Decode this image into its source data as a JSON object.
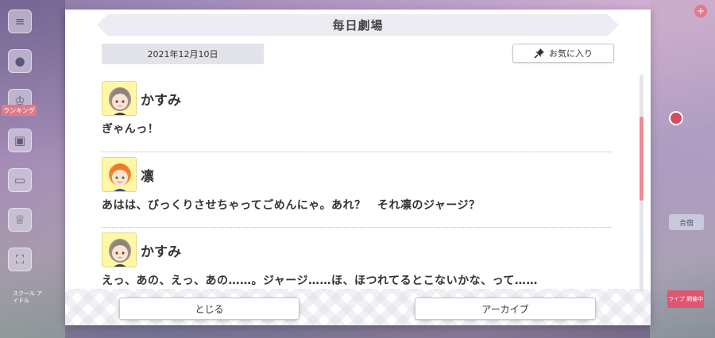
{
  "background": {
    "side_tag_text": "ランキング",
    "side_small_text": "スクール アイドル",
    "right_tag_text": "合宿",
    "right_badge_text": "ライブ 開催中"
  },
  "dialog": {
    "title": "毎日劇場",
    "date": "2021年12月10日",
    "favorite_label": "お気に入り",
    "close_label": "とじる",
    "archive_label": "アーカイブ"
  },
  "entries": [
    {
      "speaker": "かすみ",
      "avatar": "kasumi-avatar",
      "text": "ぎゃんっ！"
    },
    {
      "speaker": "凛",
      "avatar": "rin-avatar",
      "text": "あはは、びっくりさせちゃってごめんにゃ。あれ？　それ凛のジャージ？"
    },
    {
      "speaker": "かすみ",
      "avatar": "kasumi-avatar",
      "text": "えっ、あの、えっ、あの……。ジャージ……ほ、ほつれてるとこないかな、って……"
    }
  ],
  "icons": {
    "favorite": "pin-icon",
    "menu": "menu-icon"
  },
  "colors": {
    "scroll_thumb": "#ef8a95",
    "header_bg": "#ececf2",
    "avatar_bg": "#fff7a6"
  }
}
